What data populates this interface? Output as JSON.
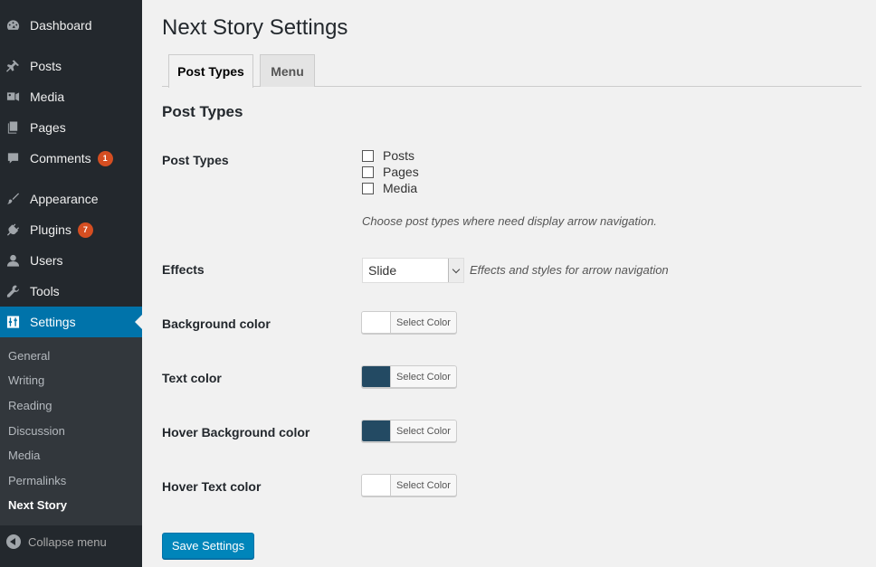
{
  "sidebar": {
    "menu": [
      {
        "label": "Dashboard",
        "icon": "dashboard-icon"
      },
      {
        "label": "Posts",
        "icon": "pin-icon"
      },
      {
        "label": "Media",
        "icon": "media-icon"
      },
      {
        "label": "Pages",
        "icon": "pages-icon"
      },
      {
        "label": "Comments",
        "icon": "comment-icon",
        "badge": "1"
      },
      {
        "label": "Appearance",
        "icon": "brush-icon"
      },
      {
        "label": "Plugins",
        "icon": "plugin-icon",
        "badge": "7"
      },
      {
        "label": "Users",
        "icon": "user-icon"
      },
      {
        "label": "Tools",
        "icon": "wrench-icon"
      },
      {
        "label": "Settings",
        "icon": "settings-icon"
      }
    ],
    "submenu": [
      "General",
      "Writing",
      "Reading",
      "Discussion",
      "Media",
      "Permalinks",
      "Next Story"
    ],
    "collapse_label": "Collapse menu"
  },
  "page_title": "Next Story Settings",
  "tabs": [
    "Post Types",
    "Menu"
  ],
  "section_title": "Post Types",
  "fields": {
    "post_types": {
      "label": "Post Types",
      "options": [
        "Posts",
        "Pages",
        "Media"
      ],
      "description": "Choose post types where need display arrow navigation."
    },
    "effects": {
      "label": "Effects",
      "value": "Slide",
      "description": "Effects and styles for arrow navigation"
    },
    "background_color": {
      "label": "Background color",
      "button": "Select Color",
      "color": "#ffffff"
    },
    "text_color": {
      "label": "Text color",
      "button": "Select Color",
      "color": "#234a63"
    },
    "hover_background_color": {
      "label": "Hover Background color",
      "button": "Select Color",
      "color": "#234a63"
    },
    "hover_text_color": {
      "label": "Hover Text color",
      "button": "Select Color",
      "color": "#ffffff"
    }
  },
  "save_label": "Save Settings",
  "colors": {
    "accent": "#0073aa",
    "sidebar": "#23282d",
    "badge": "#d54e21"
  }
}
